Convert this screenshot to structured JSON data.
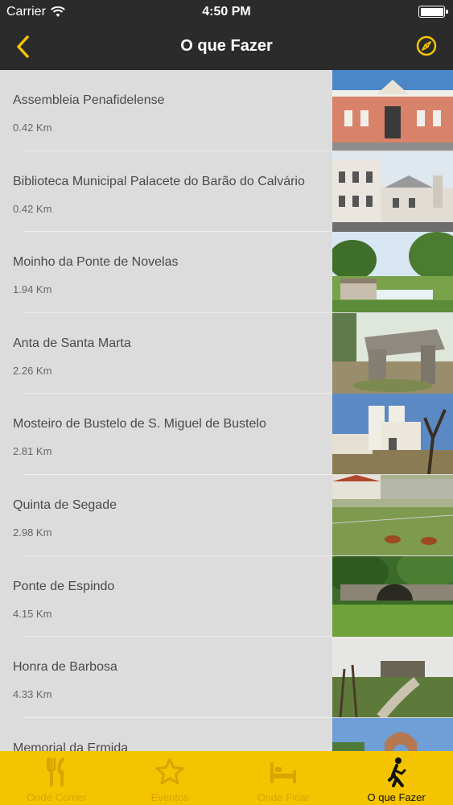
{
  "status_bar": {
    "carrier": "Carrier",
    "time": "4:50 PM"
  },
  "nav": {
    "title": "O que Fazer",
    "back_icon": "chevron-left-icon",
    "right_icon": "compass-icon",
    "accent_color": "#f5c400"
  },
  "places": [
    {
      "name": "Assembleia Penafidelense",
      "distance": "0.42 Km"
    },
    {
      "name": "Biblioteca Municipal Palacete do Barão do Calvário",
      "distance": "0.42 Km"
    },
    {
      "name": "Moinho da Ponte de Novelas",
      "distance": "1.94 Km"
    },
    {
      "name": "Anta de Santa Marta",
      "distance": "2.26 Km"
    },
    {
      "name": "Mosteiro de Bustelo de S. Miguel de Bustelo",
      "distance": "2.81 Km"
    },
    {
      "name": "Quinta de Segade",
      "distance": "2.98 Km"
    },
    {
      "name": "Ponte de Espindo",
      "distance": "4.15 Km"
    },
    {
      "name": "Honra de Barbosa",
      "distance": "4.33 Km"
    },
    {
      "name": "Memorial da Ermida",
      "distance": ""
    }
  ],
  "tabs": [
    {
      "label": "Onde Comer",
      "icon": "fork-knife-icon",
      "active": false
    },
    {
      "label": "Eventos",
      "icon": "star-icon",
      "active": false
    },
    {
      "label": "Onde Ficar",
      "icon": "bed-icon",
      "active": false
    },
    {
      "label": "O que Fazer",
      "icon": "hiker-icon",
      "active": true
    }
  ]
}
